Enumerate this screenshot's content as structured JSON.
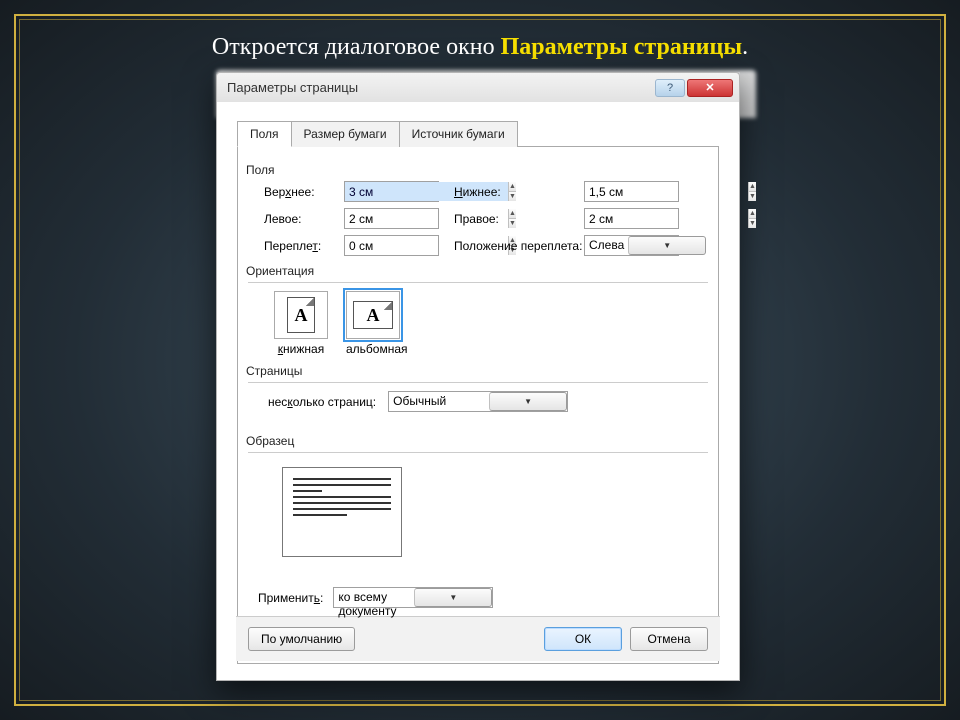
{
  "caption": {
    "prefix": "Откроется диалоговое окно ",
    "highlight": "Параметры страницы",
    "suffix": "."
  },
  "dialog": {
    "title": "Параметры страницы",
    "help": "?",
    "close": "✕",
    "tabs": {
      "margins": "Поля",
      "paper": "Размер бумаги",
      "source": "Источник бумаги"
    },
    "margins_group": "Поля",
    "fields": {
      "top_label": "Верхнее:",
      "top_underline": "х",
      "bottom_label": "Нижнее:",
      "bottom_underline": "Н",
      "left_label": "Левое:",
      "right_label": "Правое:",
      "gutter_label": "Переплет:",
      "gutter_underline": "т",
      "gutter_pos_label": "Положение переплета:",
      "top": "3 см",
      "bottom": "1,5 см",
      "left": "2 см",
      "right": "2 см",
      "gutter": "0 см",
      "gutter_pos": "Слева"
    },
    "orientation": {
      "title": "Ориентация",
      "portrait": "книжная",
      "landscape": "альбомная",
      "glyph": "A"
    },
    "pages": {
      "title": "Страницы",
      "label": "несколько страниц:",
      "label_underline": "к",
      "value": "Обычный"
    },
    "preview": {
      "title": "Образец"
    },
    "apply": {
      "label": "Применить:",
      "label_underline": "ь",
      "value": "ко всему документу"
    },
    "footer": {
      "default": "По умолчанию",
      "ok": "ОК",
      "cancel": "Отмена"
    }
  }
}
